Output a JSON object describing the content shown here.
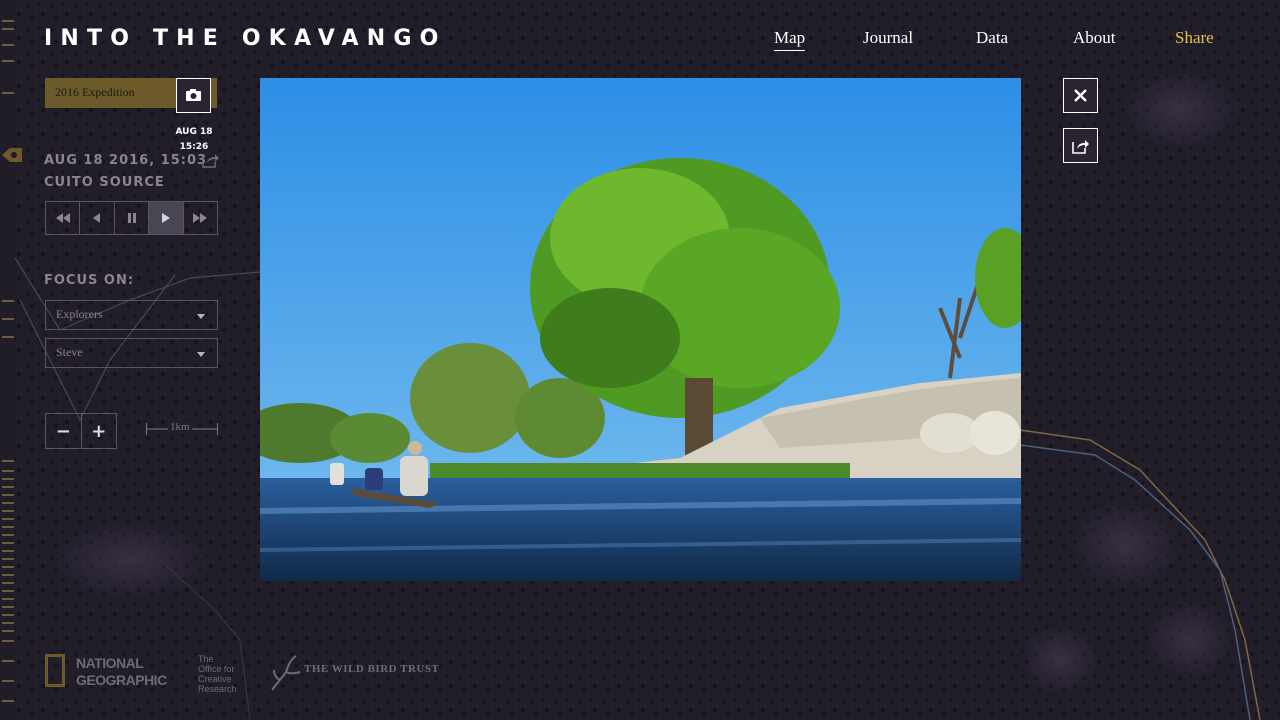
{
  "app": {
    "logo": "INTO THE OKAVANGO"
  },
  "nav": {
    "map": "Map",
    "journal": "Journal",
    "data": "Data",
    "about": "About",
    "share": "Share"
  },
  "sidebar": {
    "expedition_select": "2016 Expedition",
    "camera_time_date": "AUG 18",
    "camera_time_clock": "15:26",
    "post_datetime": "AUG 18 2016, 15:03",
    "post_location": "CUITO SOURCE",
    "focus_label": "FOCUS ON:",
    "focus_category": "Explorers",
    "focus_person": "Steve",
    "scale_label": "1km",
    "playback_active": "play"
  },
  "sponsors": {
    "natgeo_line1": "NATIONAL",
    "natgeo_line2": "GEOGRAPHIC",
    "ocr_line1": "The",
    "ocr_line2": "Office for",
    "ocr_line3": "Creative",
    "ocr_line4": "Research",
    "wbt": "THE WILD BIRD TRUST"
  },
  "icons": {
    "close": "close-icon",
    "share": "share-icon",
    "camera": "camera-icon"
  },
  "colors": {
    "accent_gold": "#e7c04c",
    "expedition_bg": "#6d5a2a",
    "background": "#1d1a26"
  }
}
